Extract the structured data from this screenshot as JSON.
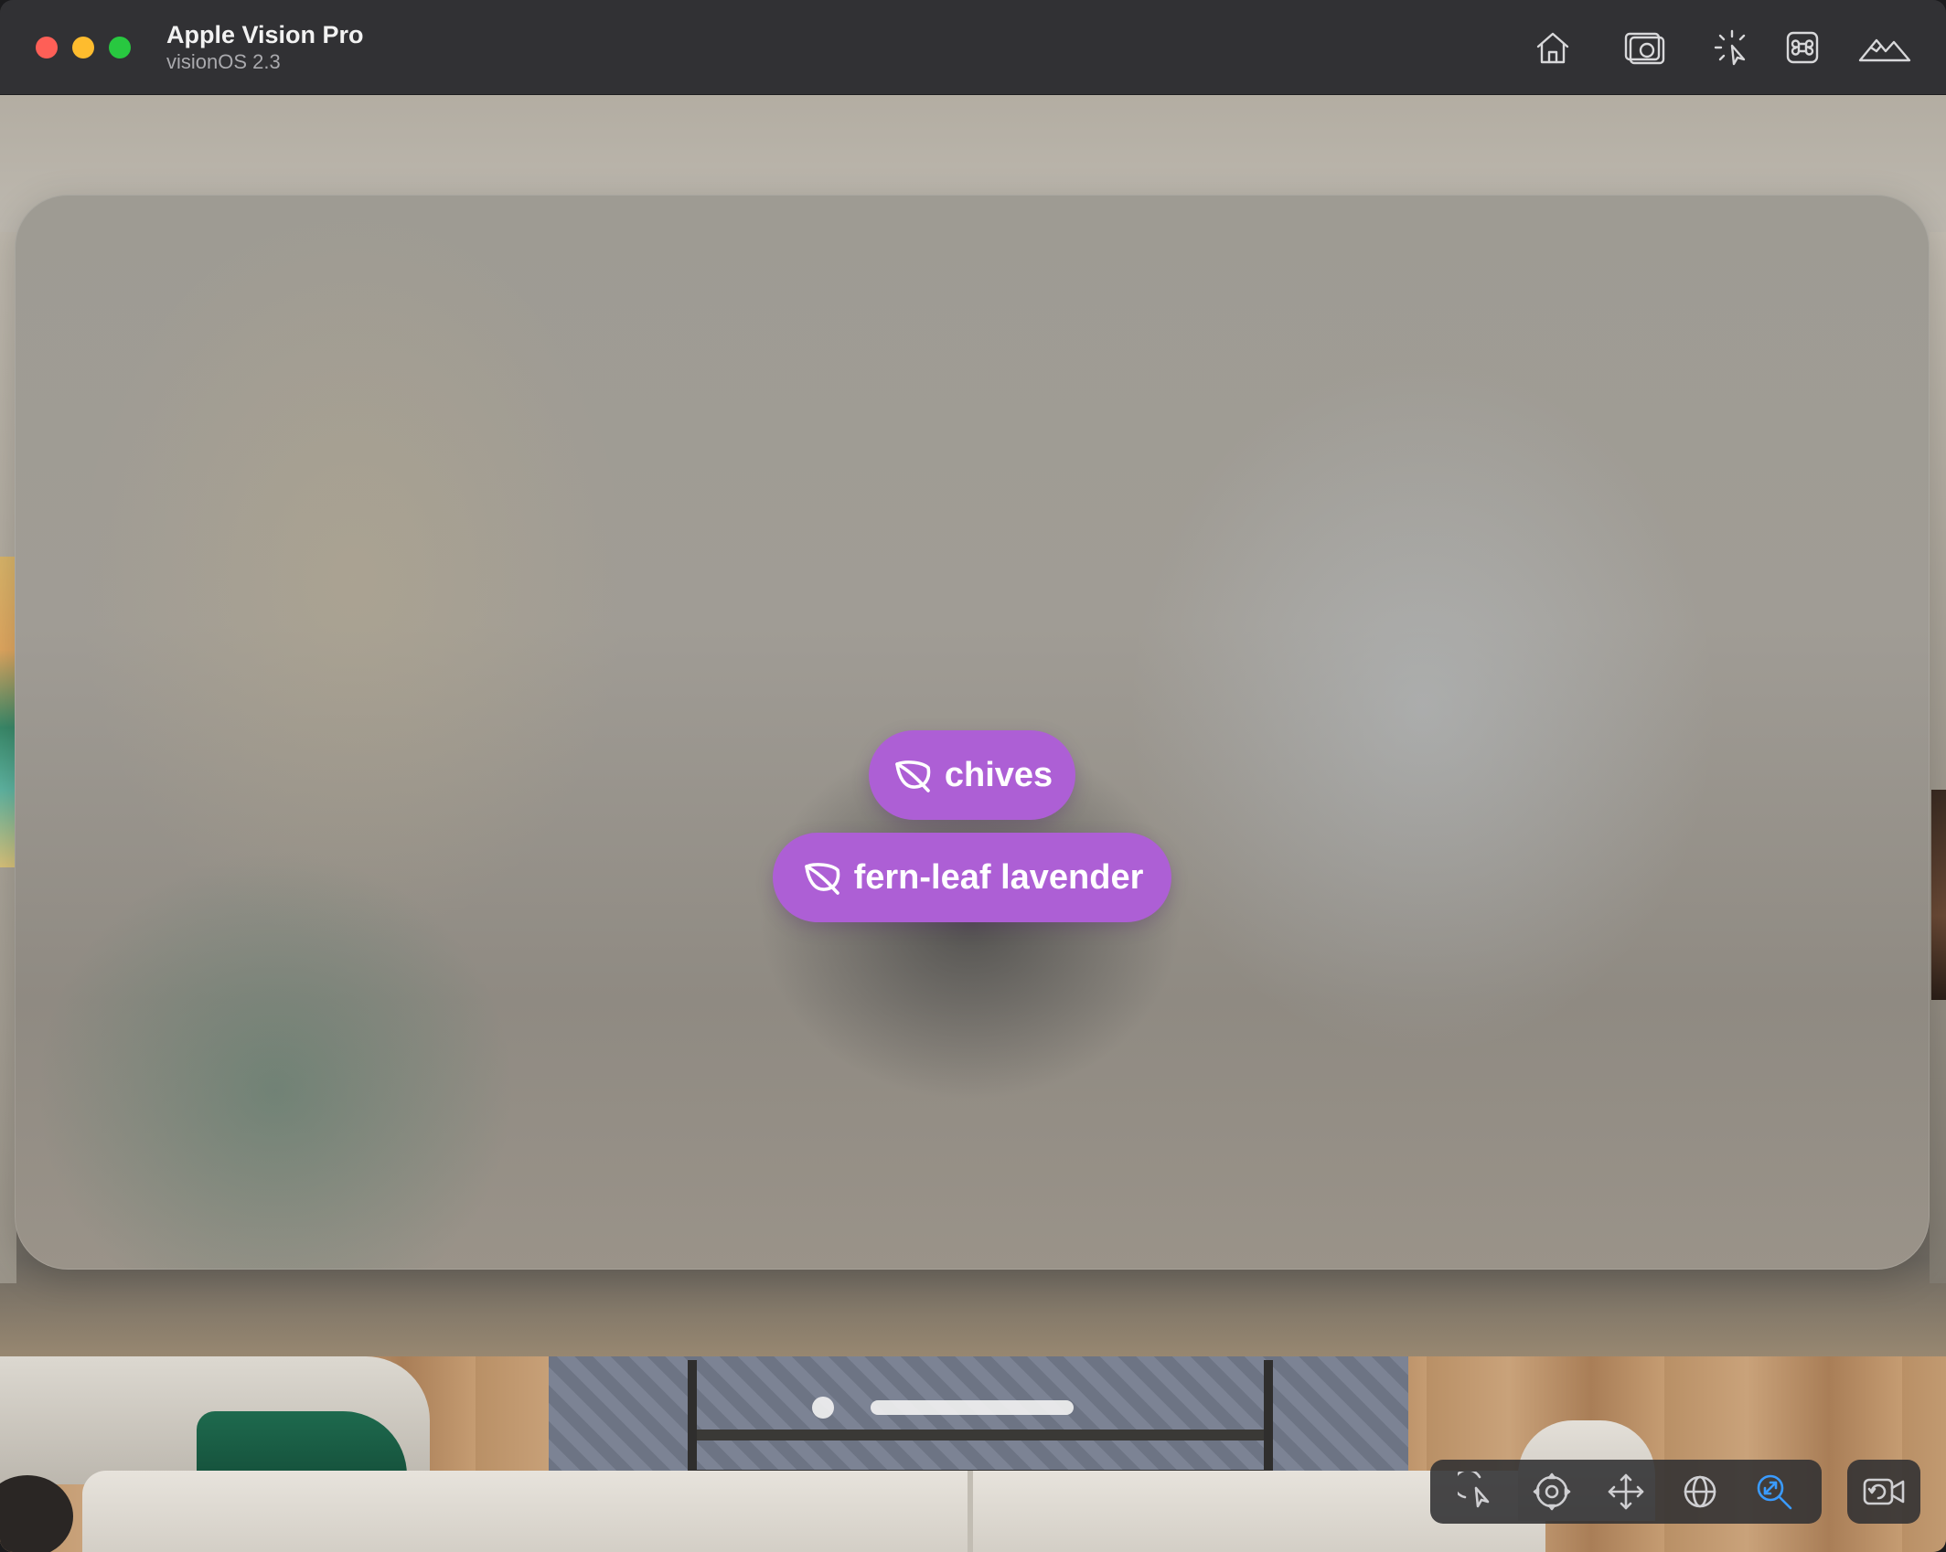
{
  "window": {
    "title": "Apple Vision Pro",
    "subtitle": "visionOS 2.3"
  },
  "titlebar_icons": [
    "home-icon",
    "screenshot-camera-icon",
    "pointer-tap-icon",
    "command-key-icon",
    "environment-mountains-icon"
  ],
  "ornaments": [
    {
      "label": "chives",
      "icon": "leaf-icon"
    },
    {
      "label": "fern-leaf lavender",
      "icon": "leaf-icon"
    }
  ],
  "toolbar": {
    "tools": [
      "select-pointer-icon",
      "look-around-icon",
      "pan-icon",
      "orbit-icon",
      "zoom-icon"
    ],
    "active_tool": "zoom-icon",
    "camera_button": "camera-reset-icon"
  },
  "colors": {
    "ornament_bg": "#ad5fd5",
    "active_tool": "#3a9bff",
    "traffic_close": "#fe5f57",
    "traffic_minimize": "#febc2e",
    "traffic_maximize": "#28c840"
  }
}
